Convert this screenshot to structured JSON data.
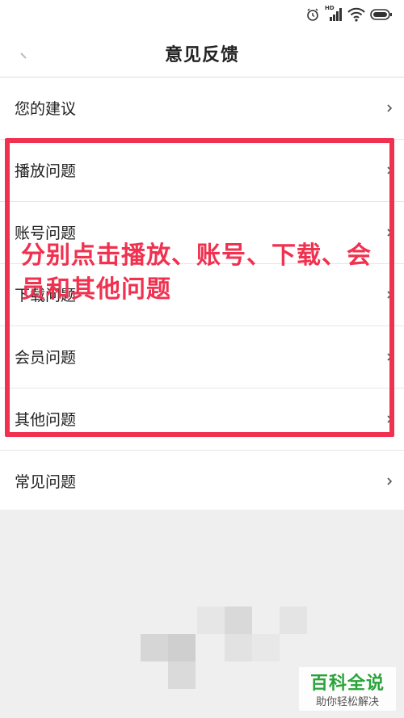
{
  "status_bar": {
    "icons": [
      "alarm-icon",
      "hd-signal-icon",
      "wifi-icon",
      "battery-icon"
    ],
    "hd_label": "HD"
  },
  "header": {
    "title": "意见反馈",
    "back_icon": "back-arrow-icon"
  },
  "list": {
    "items": [
      {
        "label": "您的建议"
      },
      {
        "label": "播放问题"
      },
      {
        "label": "账号问题"
      },
      {
        "label": "下载问题"
      },
      {
        "label": "会员问题"
      },
      {
        "label": "其他问题"
      },
      {
        "label": "常见问题"
      }
    ]
  },
  "annotation": {
    "text": "分别点击播放、账号、下载、会员和其他问题",
    "color": "#f0314f"
  },
  "watermark": {
    "title": "百科全说",
    "subtitle": "助你轻松解决",
    "color": "#2aa33a"
  }
}
